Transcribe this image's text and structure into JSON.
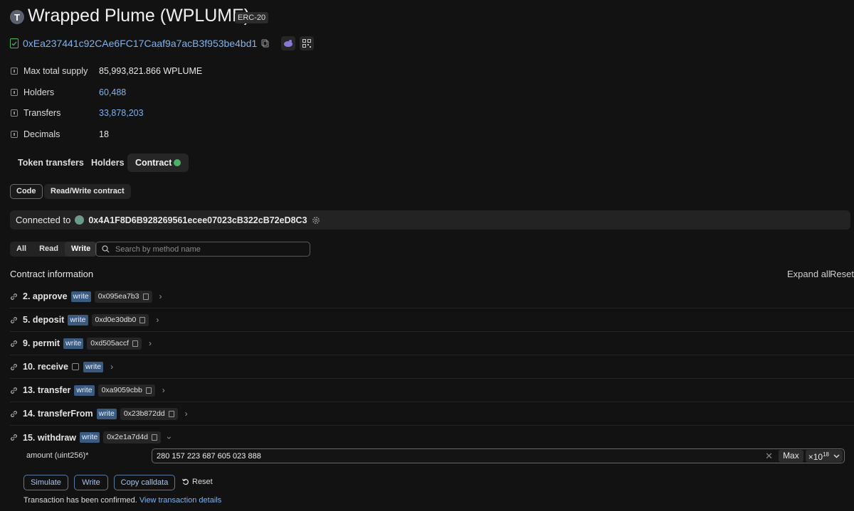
{
  "header": {
    "avatar_letter": "T",
    "title": "Wrapped Plume (WPLUME)",
    "standard_badge": "ERC-20",
    "address": "0xEa237441c92CAe6FC17Caaf9a7acB3f953be4bd1"
  },
  "info": [
    {
      "label": "Max total supply",
      "value": "85,993,821.866 WPLUME",
      "link": false
    },
    {
      "label": "Holders",
      "value": "60,488",
      "link": true
    },
    {
      "label": "Transfers",
      "value": "33,878,203",
      "link": true
    },
    {
      "label": "Decimals",
      "value": "18",
      "link": false
    }
  ],
  "tabs": {
    "token_transfers": "Token transfers",
    "holders": "Holders",
    "contract": "Contract"
  },
  "sub_tabs": {
    "code": "Code",
    "read_write": "Read/Write contract"
  },
  "connected": {
    "label": "Connected to",
    "address": "0x4A1F8D6B928269561ecee07023cB322cB72eD8C3"
  },
  "filters": {
    "all": "All",
    "read": "Read",
    "write": "Write",
    "search_placeholder": "Search by method name"
  },
  "contract_info": {
    "title": "Contract information",
    "expand_all": "Expand all",
    "reset": "Reset"
  },
  "write_tag": "write",
  "methods": [
    {
      "name": "2. approve",
      "selector": "0x095ea7b3"
    },
    {
      "name": "5. deposit",
      "selector": "0xd0e30db0"
    },
    {
      "name": "9. permit",
      "selector": "0xd505accf"
    },
    {
      "name": "10. receive",
      "selector": ""
    },
    {
      "name": "13. transfer",
      "selector": "0xa9059cbb"
    },
    {
      "name": "14. transferFrom",
      "selector": "0x23b872dd"
    },
    {
      "name": "15. withdraw",
      "selector": "0x2e1a7d4d"
    }
  ],
  "withdraw_form": {
    "arg_label": "amount (uint256)*",
    "arg_value": "280 157 223 687 605 023 888",
    "max_label": "Max",
    "multiplier_base": "×10",
    "multiplier_exp": "18",
    "simulate": "Simulate",
    "write": "Write",
    "copy_calldata": "Copy calldata",
    "reset": "Reset",
    "status_text": "Transaction has been confirmed.",
    "status_link": "View transaction details"
  }
}
